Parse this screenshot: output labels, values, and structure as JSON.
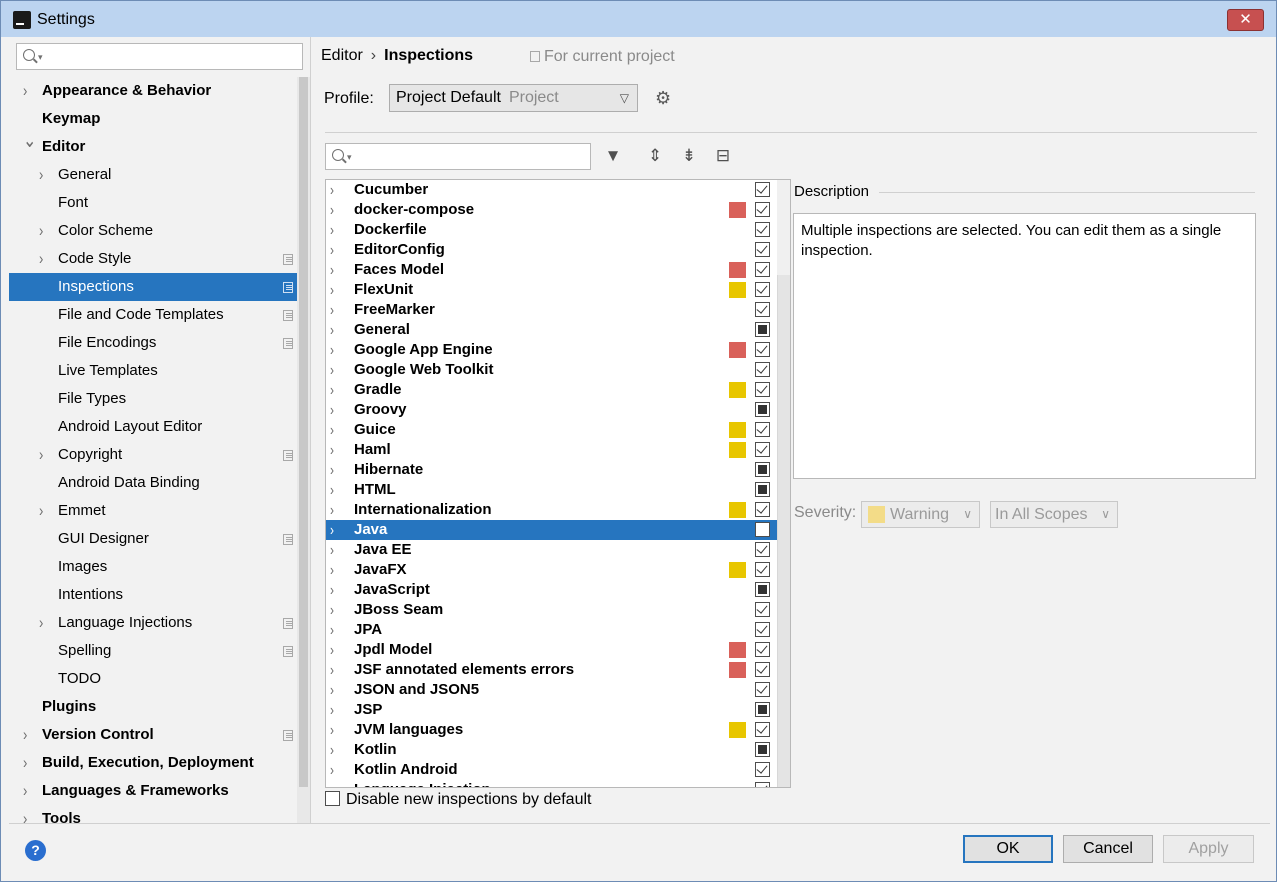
{
  "window": {
    "title": "Settings",
    "close_glyph": "✕"
  },
  "left": {
    "tree": [
      {
        "label": "Appearance & Behavior",
        "bold": true,
        "chevron": true,
        "indent": 0,
        "proj": false
      },
      {
        "label": "Keymap",
        "bold": true,
        "chevron": false,
        "indent": 0,
        "proj": false
      },
      {
        "label": "Editor",
        "bold": true,
        "chevron": "open",
        "indent": 0,
        "proj": false
      },
      {
        "label": "General",
        "bold": false,
        "chevron": true,
        "indent": 1,
        "proj": false
      },
      {
        "label": "Font",
        "bold": false,
        "chevron": false,
        "indent": 1,
        "proj": false
      },
      {
        "label": "Color Scheme",
        "bold": false,
        "chevron": true,
        "indent": 1,
        "proj": false
      },
      {
        "label": "Code Style",
        "bold": false,
        "chevron": true,
        "indent": 1,
        "proj": true
      },
      {
        "label": "Inspections",
        "bold": false,
        "chevron": false,
        "indent": 1,
        "proj": true,
        "selected": true
      },
      {
        "label": "File and Code Templates",
        "bold": false,
        "chevron": false,
        "indent": 1,
        "proj": true
      },
      {
        "label": "File Encodings",
        "bold": false,
        "chevron": false,
        "indent": 1,
        "proj": true
      },
      {
        "label": "Live Templates",
        "bold": false,
        "chevron": false,
        "indent": 1,
        "proj": false
      },
      {
        "label": "File Types",
        "bold": false,
        "chevron": false,
        "indent": 1,
        "proj": false
      },
      {
        "label": "Android Layout Editor",
        "bold": false,
        "chevron": false,
        "indent": 1,
        "proj": false
      },
      {
        "label": "Copyright",
        "bold": false,
        "chevron": true,
        "indent": 1,
        "proj": true
      },
      {
        "label": "Android Data Binding",
        "bold": false,
        "chevron": false,
        "indent": 1,
        "proj": false
      },
      {
        "label": "Emmet",
        "bold": false,
        "chevron": true,
        "indent": 1,
        "proj": false
      },
      {
        "label": "GUI Designer",
        "bold": false,
        "chevron": false,
        "indent": 1,
        "proj": true
      },
      {
        "label": "Images",
        "bold": false,
        "chevron": false,
        "indent": 1,
        "proj": false
      },
      {
        "label": "Intentions",
        "bold": false,
        "chevron": false,
        "indent": 1,
        "proj": false
      },
      {
        "label": "Language Injections",
        "bold": false,
        "chevron": true,
        "indent": 1,
        "proj": true
      },
      {
        "label": "Spelling",
        "bold": false,
        "chevron": false,
        "indent": 1,
        "proj": true
      },
      {
        "label": "TODO",
        "bold": false,
        "chevron": false,
        "indent": 1,
        "proj": false
      },
      {
        "label": "Plugins",
        "bold": true,
        "chevron": false,
        "indent": 0,
        "proj": false
      },
      {
        "label": "Version Control",
        "bold": true,
        "chevron": true,
        "indent": 0,
        "proj": true
      },
      {
        "label": "Build, Execution, Deployment",
        "bold": true,
        "chevron": true,
        "indent": 0,
        "proj": false
      },
      {
        "label": "Languages & Frameworks",
        "bold": true,
        "chevron": true,
        "indent": 0,
        "proj": false
      },
      {
        "label": "Tools",
        "bold": true,
        "chevron": true,
        "indent": 0,
        "proj": false
      }
    ]
  },
  "right": {
    "breadcrumb": {
      "parent": "Editor",
      "sep": "›",
      "current": "Inspections"
    },
    "for_project": "For current project",
    "profile": {
      "label": "Profile:",
      "value": "Project Default",
      "scope": "Project"
    },
    "inspections": [
      {
        "name": "Cucumber",
        "sev": "",
        "state": "checked"
      },
      {
        "name": "docker-compose",
        "sev": "error",
        "state": "checked"
      },
      {
        "name": "Dockerfile",
        "sev": "",
        "state": "checked"
      },
      {
        "name": "EditorConfig",
        "sev": "",
        "state": "checked"
      },
      {
        "name": "Faces Model",
        "sev": "error",
        "state": "checked"
      },
      {
        "name": "FlexUnit",
        "sev": "warning",
        "state": "checked"
      },
      {
        "name": "FreeMarker",
        "sev": "",
        "state": "checked"
      },
      {
        "name": "General",
        "sev": "",
        "state": "partial"
      },
      {
        "name": "Google App Engine",
        "sev": "error",
        "state": "checked"
      },
      {
        "name": "Google Web Toolkit",
        "sev": "",
        "state": "checked"
      },
      {
        "name": "Gradle",
        "sev": "warning",
        "state": "checked"
      },
      {
        "name": "Groovy",
        "sev": "",
        "state": "partial"
      },
      {
        "name": "Guice",
        "sev": "warning",
        "state": "checked"
      },
      {
        "name": "Haml",
        "sev": "warning",
        "state": "checked"
      },
      {
        "name": "Hibernate",
        "sev": "",
        "state": "partial"
      },
      {
        "name": "HTML",
        "sev": "",
        "state": "partial"
      },
      {
        "name": "Internationalization",
        "sev": "warning",
        "state": "checked"
      },
      {
        "name": "Java",
        "sev": "",
        "state": "partial",
        "selected": true
      },
      {
        "name": "Java EE",
        "sev": "",
        "state": "checked"
      },
      {
        "name": "JavaFX",
        "sev": "warning",
        "state": "checked"
      },
      {
        "name": "JavaScript",
        "sev": "",
        "state": "partial"
      },
      {
        "name": "JBoss Seam",
        "sev": "",
        "state": "checked"
      },
      {
        "name": "JPA",
        "sev": "",
        "state": "checked"
      },
      {
        "name": "Jpdl Model",
        "sev": "error",
        "state": "checked"
      },
      {
        "name": "JSF annotated elements errors",
        "sev": "error",
        "state": "checked"
      },
      {
        "name": "JSON and JSON5",
        "sev": "",
        "state": "checked"
      },
      {
        "name": "JSP",
        "sev": "",
        "state": "partial"
      },
      {
        "name": "JVM languages",
        "sev": "warning",
        "state": "checked"
      },
      {
        "name": "Kotlin",
        "sev": "",
        "state": "partial"
      },
      {
        "name": "Kotlin Android",
        "sev": "",
        "state": "checked"
      },
      {
        "name": "Language Injection",
        "sev": "",
        "state": "checked"
      }
    ],
    "description": {
      "title": "Description",
      "text": "Multiple inspections are selected. You can edit them as a single inspection."
    },
    "severity": {
      "label": "Severity:",
      "value": "Warning",
      "scope": "In All Scopes"
    },
    "disable_new": "Disable new inspections by default"
  },
  "colors": {
    "error": "#d9615a",
    "warning": "#e8c600",
    "selection": "#2675bf"
  },
  "buttons": {
    "ok": "OK",
    "cancel": "Cancel",
    "apply": "Apply",
    "help": "?"
  }
}
